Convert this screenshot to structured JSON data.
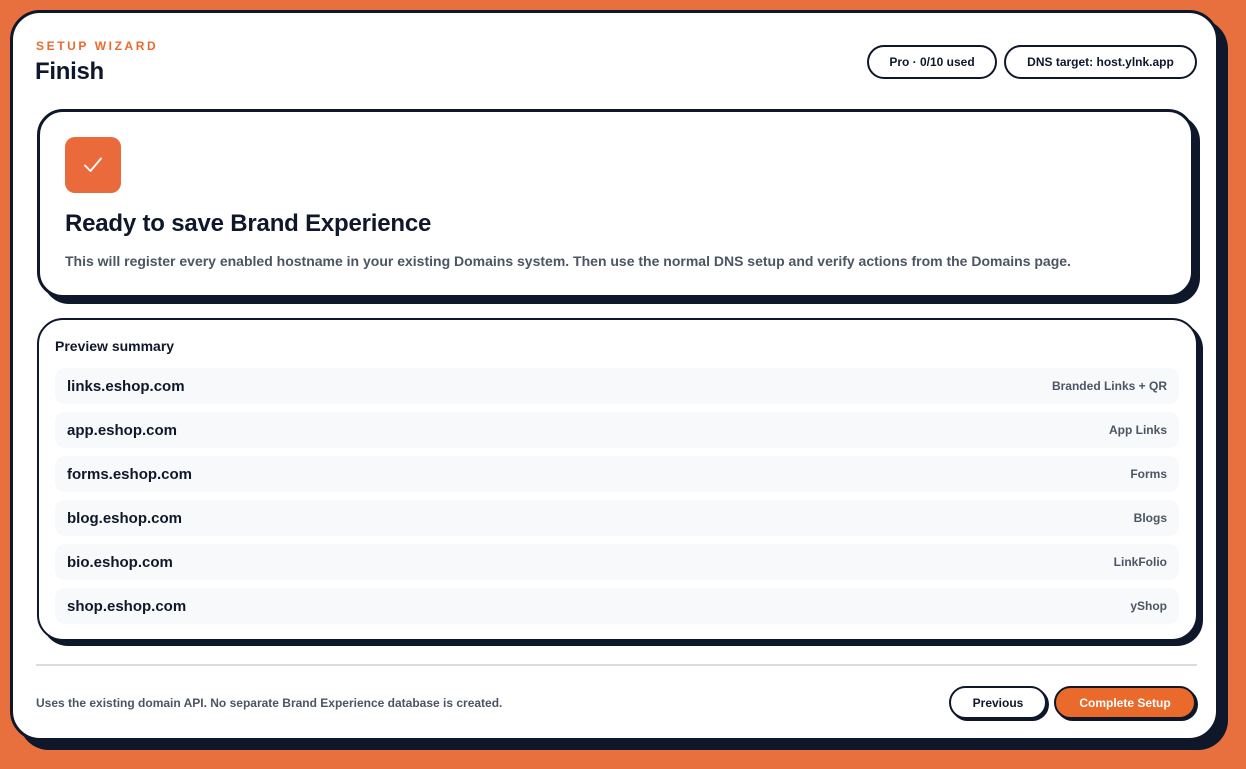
{
  "header": {
    "eyebrow": "SETUP WIZARD",
    "title": "Finish",
    "plan_badge": "Pro · 0/10 used",
    "dns_badge": "DNS target: host.ylnk.app"
  },
  "hero": {
    "icon": "check-icon",
    "title": "Ready to save Brand Experience",
    "description": "This will register every enabled hostname in your existing Domains system. Then use the normal DNS setup and verify actions from the Domains page."
  },
  "summary": {
    "title": "Preview summary",
    "rows": [
      {
        "host": "links.eshop.com",
        "product": "Branded Links + QR"
      },
      {
        "host": "app.eshop.com",
        "product": "App Links"
      },
      {
        "host": "forms.eshop.com",
        "product": "Forms"
      },
      {
        "host": "blog.eshop.com",
        "product": "Blogs"
      },
      {
        "host": "bio.eshop.com",
        "product": "LinkFolio"
      },
      {
        "host": "shop.eshop.com",
        "product": "yShop"
      }
    ]
  },
  "footer": {
    "note": "Uses the existing domain API. No separate Brand Experience database is created.",
    "previous_label": "Previous",
    "complete_label": "Complete Setup"
  },
  "colors": {
    "accent": "#ea6a2c",
    "ink": "#0f172a",
    "background": "#e8703f"
  }
}
